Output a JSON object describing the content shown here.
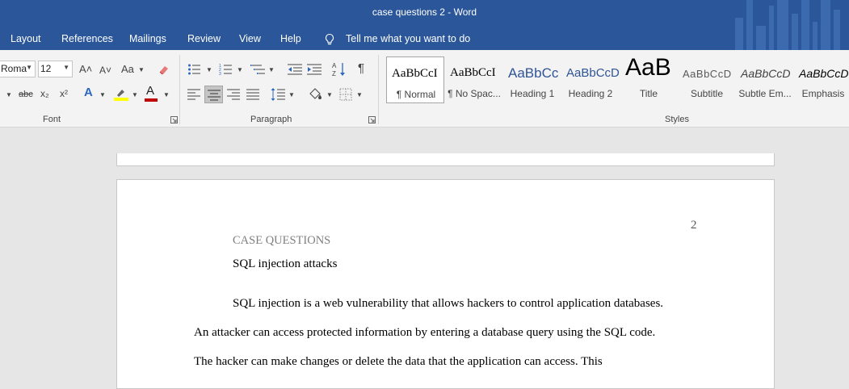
{
  "window": {
    "title": "case questions 2  -  Word"
  },
  "menu": {
    "items": [
      "Layout",
      "References",
      "Mailings",
      "Review",
      "View",
      "Help"
    ],
    "tell_me": "Tell me what you want to do"
  },
  "ribbon": {
    "font": {
      "name": "Roma",
      "size": "12",
      "grow_icon": "A˄",
      "shrink_icon": "A˅",
      "change_case": "Aa",
      "strikethrough": "abc",
      "subscript": "x₂",
      "superscript": "x²",
      "font_color_letter": "A",
      "label": "Font"
    },
    "paragraph": {
      "label": "Paragraph"
    },
    "styles": {
      "label": "Styles",
      "items": [
        {
          "preview": "AaBbCcI",
          "name": "¶ Normal"
        },
        {
          "preview": "AaBbCcI",
          "name": "¶ No Spac..."
        },
        {
          "preview": "AaBbCc",
          "name": "Heading 1"
        },
        {
          "preview": "AaBbCcD",
          "name": "Heading 2"
        },
        {
          "preview": "AaB",
          "name": "Title"
        },
        {
          "preview": "AaBbCcD",
          "name": "Subtitle"
        },
        {
          "preview": "AaBbCcD",
          "name": "Subtle Em..."
        },
        {
          "preview": "AaBbCcD",
          "name": "Emphasis"
        }
      ]
    },
    "colors": {
      "highlight": "#ffff00",
      "font_color": "#c00000"
    }
  },
  "document": {
    "page_number": "2",
    "header_text": "CASE QUESTIONS",
    "heading": "SQL injection attacks",
    "lines": [
      "SQL injection is a web vulnerability that allows hackers to control application databases.",
      "An attacker can access protected information by entering a database query using the SQL code.",
      "The hacker can make changes or delete the data that the application can access. This"
    ]
  }
}
